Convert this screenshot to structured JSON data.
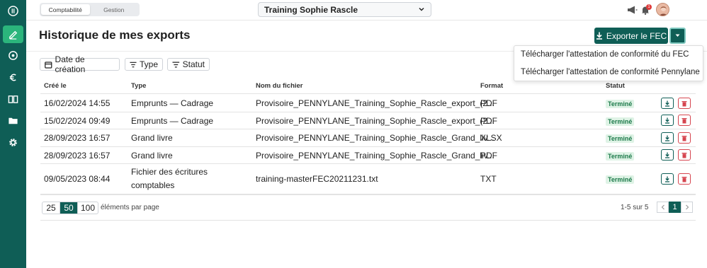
{
  "topbar": {
    "tabs": [
      {
        "label": "Comptabilité",
        "active": true
      },
      {
        "label": "Gestion",
        "active": false
      }
    ],
    "company": "Training Sophie Rascle",
    "notification_count": "1"
  },
  "page": {
    "title": "Historique de mes exports",
    "export_button": "Exporter le FEC"
  },
  "menu": {
    "items": [
      "Télécharger l'attestation de conformité du FEC",
      "Télécharger l'attestation de conformité Pennylane"
    ]
  },
  "filters": [
    {
      "label": "Date de création",
      "icon": "calendar-icon"
    },
    {
      "label": "Type",
      "icon": "filter-icon"
    },
    {
      "label": "Statut",
      "icon": "filter-icon"
    }
  ],
  "table": {
    "columns": [
      "Créé le",
      "Type",
      "Nom du fichier",
      "Format",
      "Statut"
    ],
    "rows": [
      {
        "date": "16/02/2024 14:55",
        "type": "Emprunts — Cadrage",
        "file": "Provisoire_PENNYLANE_Training_Sophie_Rascle_export_(2...",
        "format": "PDF",
        "status": "Terminé"
      },
      {
        "date": "15/02/2024 09:49",
        "type": "Emprunts — Cadrage",
        "file": "Provisoire_PENNYLANE_Training_Sophie_Rascle_export_(2...",
        "format": "PDF",
        "status": "Terminé"
      },
      {
        "date": "28/09/2023 16:57",
        "type": "Grand livre",
        "file": "Provisoire_PENNYLANE_Training_Sophie_Rascle_Grand_liv...",
        "format": "XLSX",
        "status": "Terminé"
      },
      {
        "date": "28/09/2023 16:57",
        "type": "Grand livre",
        "file": "Provisoire_PENNYLANE_Training_Sophie_Rascle_Grand_liv...",
        "format": "PDF",
        "status": "Terminé"
      },
      {
        "date": "09/05/2023 08:44",
        "type": "Fichier des écritures comptables",
        "file": "training-masterFEC20211231.txt",
        "format": "TXT",
        "status": "Terminé"
      }
    ]
  },
  "pagination": {
    "sizes": [
      "25",
      "50",
      "100"
    ],
    "active_size": "50",
    "per_page_label": "éléments par page",
    "range_label": "1-5 sur 5",
    "current_page": "1"
  },
  "colors": {
    "brand": "#0f5e56",
    "accent": "#2bb57c",
    "status_bg": "#dff3e6",
    "danger": "#d6454f"
  }
}
